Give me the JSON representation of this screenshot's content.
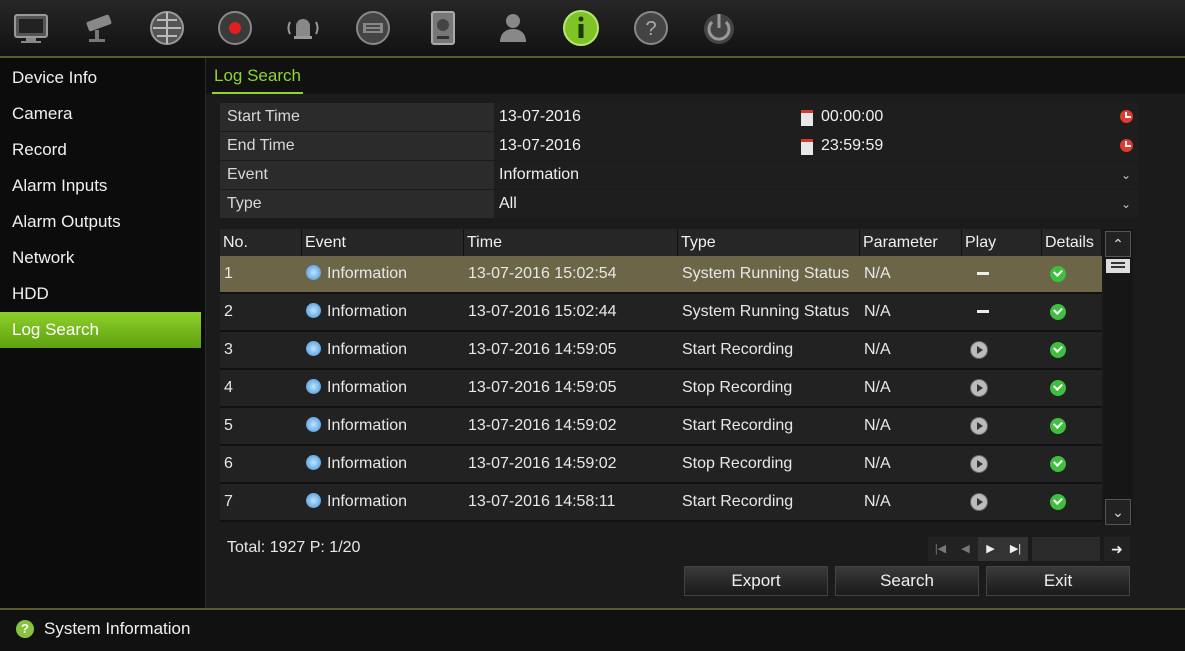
{
  "toolbar": {
    "icons": [
      "monitor-icon",
      "camera-icon",
      "network-icon",
      "record-icon",
      "alarm-icon",
      "device-icon",
      "hdd-icon",
      "user-icon",
      "info-icon",
      "help-icon",
      "power-icon"
    ],
    "active": "info-icon",
    "accent": "#8fd62c"
  },
  "sidebar": {
    "items": [
      {
        "label": "Device Info"
      },
      {
        "label": "Camera"
      },
      {
        "label": "Record"
      },
      {
        "label": "Alarm Inputs"
      },
      {
        "label": "Alarm Outputs"
      },
      {
        "label": "Network"
      },
      {
        "label": "HDD"
      },
      {
        "label": "Log Search"
      }
    ],
    "active_index": 7
  },
  "tab": {
    "label": "Log Search"
  },
  "form": {
    "start_label": "Start Time",
    "start_date": "13-07-2016",
    "start_time": "00:00:00",
    "end_label": "End Time",
    "end_date": "13-07-2016",
    "end_time": "23:59:59",
    "event_label": "Event",
    "event_value": "Information",
    "type_label": "Type",
    "type_value": "All"
  },
  "table": {
    "headers": [
      "No.",
      "Event",
      "Time",
      "Type",
      "Parameter",
      "Play",
      "Details"
    ],
    "rows": [
      {
        "no": "1",
        "event": "Information",
        "time": "13-07-2016 15:02:54",
        "type": "System Running Status",
        "param": "N/A"
      },
      {
        "no": "2",
        "event": "Information",
        "time": "13-07-2016 15:02:44",
        "type": "System Running Status",
        "param": "N/A"
      },
      {
        "no": "3",
        "event": "Information",
        "time": "13-07-2016 14:59:05",
        "type": "Start Recording",
        "param": "N/A"
      },
      {
        "no": "4",
        "event": "Information",
        "time": "13-07-2016 14:59:05",
        "type": "Stop Recording",
        "param": "N/A"
      },
      {
        "no": "5",
        "event": "Information",
        "time": "13-07-2016 14:59:02",
        "type": "Start Recording",
        "param": "N/A"
      },
      {
        "no": "6",
        "event": "Information",
        "time": "13-07-2016 14:59:02",
        "type": "Stop Recording",
        "param": "N/A"
      },
      {
        "no": "7",
        "event": "Information",
        "time": "13-07-2016 14:58:11",
        "type": "Start Recording",
        "param": "N/A"
      }
    ],
    "selected_index": 0
  },
  "footer": {
    "total": "Total: 1927  P: 1/20"
  },
  "buttons": {
    "export": "Export",
    "search": "Search",
    "exit": "Exit"
  },
  "status": {
    "text": "System Information"
  }
}
